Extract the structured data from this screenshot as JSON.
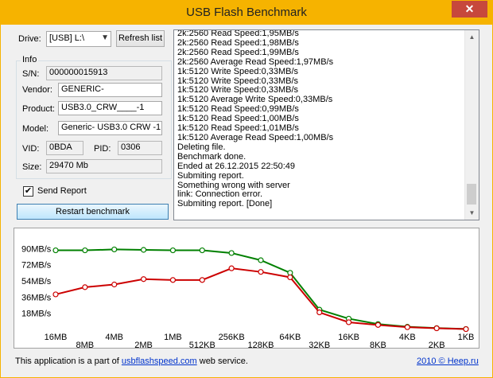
{
  "window": {
    "title": "USB Flash Benchmark",
    "close_icon": "close-icon"
  },
  "drive": {
    "label": "Drive:",
    "selected": "[USB] L:\\",
    "refresh_label": "Refresh list"
  },
  "info": {
    "legend": "Info",
    "sn_label": "S/N:",
    "sn_value": "000000015913",
    "vendor_label": "Vendor:",
    "vendor_value": "GENERIC-",
    "product_label": "Product:",
    "product_value": "USB3.0_CRW____-1",
    "model_label": "Model:",
    "model_value": "Generic- USB3.0 CRW   -1",
    "vid_label": "VID:",
    "vid_value": "0BDA",
    "pid_label": "PID:",
    "pid_value": "0306",
    "size_label": "Size:",
    "size_value": "29470 Mb"
  },
  "send_report": {
    "label": "Send Report",
    "checked": true,
    "check_glyph": "✔"
  },
  "restart_label": "Restart benchmark",
  "log": [
    "2k:2560 Read Speed:1,95MB/s",
    "2k:2560 Read Speed:1,98MB/s",
    "2k:2560 Read Speed:1,99MB/s",
    "2k:2560 Average Read Speed:1,97MB/s",
    "1k:5120 Write Speed:0,33MB/s",
    "1k:5120 Write Speed:0,33MB/s",
    "1k:5120 Write Speed:0,33MB/s",
    "1k:5120 Average Write Speed:0,33MB/s",
    "1k:5120 Read Speed:0,99MB/s",
    "1k:5120 Read Speed:1,00MB/s",
    "1k:5120 Read Speed:1,01MB/s",
    "1k:5120 Average Read Speed:1,00MB/s",
    "Deleting file.",
    "Benchmark done.",
    "Ended at 26.12.2015 22:50:49",
    "Submiting report.",
    "Something wrong with server",
    "link: Connection error.",
    "Submiting report. [Done]"
  ],
  "chart_data": {
    "type": "line",
    "categories": [
      "16MB",
      "8MB",
      "4MB",
      "2MB",
      "1MB",
      "512KB",
      "256KB",
      "128KB",
      "64KB",
      "32KB",
      "16KB",
      "8KB",
      "4KB",
      "2KB",
      "1KB"
    ],
    "y_ticks": [
      "90MB/s",
      "72MB/s",
      "54MB/s",
      "36MB/s",
      "18MB/s"
    ],
    "y_tick_values": [
      90,
      72,
      54,
      36,
      18
    ],
    "ylim": [
      0,
      100
    ],
    "grid": false,
    "series": [
      {
        "color": "#008000",
        "values": [
          88,
          88,
          89,
          88.5,
          88,
          88,
          85,
          77,
          63,
          22,
          12,
          6,
          3,
          1.5,
          0.5
        ]
      },
      {
        "color": "#cc0000",
        "values": [
          39,
          47,
          50,
          56,
          55,
          55,
          68,
          64,
          58,
          19,
          8,
          5,
          2.5,
          1.3,
          0.4
        ]
      }
    ]
  },
  "footer": {
    "text_before": "This application is a part of ",
    "link": "usbflashspeed.com",
    "text_after": " web service.",
    "copyright": "2010 © Heep.ru"
  }
}
